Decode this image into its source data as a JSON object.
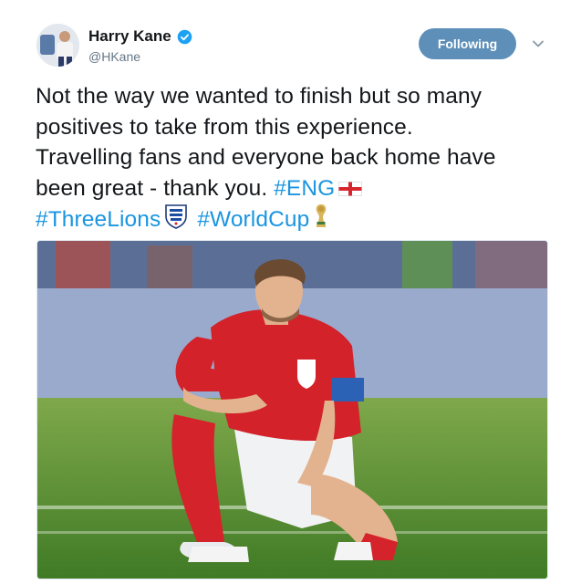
{
  "user": {
    "display_name": "Harry Kane",
    "handle": "@HKane",
    "verified": true
  },
  "follow_button": {
    "label": "Following"
  },
  "tweet": {
    "lines": [
      "Not the way we wanted to finish but so many",
      "positives to take from this experience.",
      "Travelling fans and everyone back home have"
    ],
    "line4_text": "been great - thank you. ",
    "hashtags": {
      "eng": "#ENG",
      "three_lions": "#ThreeLions",
      "world_cup": "#WorldCup"
    },
    "emoji": [
      "england-flag-icon",
      "england-crest-icon",
      "world-cup-trophy-icon"
    ]
  },
  "colors": {
    "link": "#1b95e0",
    "following_button": "#5d8fb9",
    "verified_badge": "#1da1f2",
    "handle": "#657786"
  },
  "media": {
    "type": "photo",
    "subject": "player-kneeling-on-pitch"
  }
}
